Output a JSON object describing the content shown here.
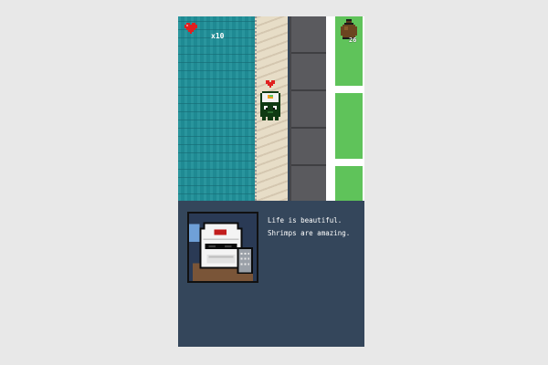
{
  "hud": {
    "lives_label": "x10",
    "coins_label": "26",
    "heart_icon": "heart-icon",
    "bag_icon": "money-bag-icon"
  },
  "world": {
    "terrain": [
      "water",
      "sand",
      "road",
      "sidewalk",
      "grass"
    ],
    "player": "sushi-roll-character",
    "player_marker": "heart"
  },
  "dialog": {
    "speaker": "old-man-portrait",
    "lines": [
      "Life is beautiful.",
      "Shrimps are amazing."
    ]
  },
  "colors": {
    "water": "#1f8a93",
    "sand": "#e7ddc7",
    "road": "#5a5a5e",
    "grass": "#5fc35a",
    "dialog_bg": "#34465b",
    "heart": "#e02020"
  }
}
